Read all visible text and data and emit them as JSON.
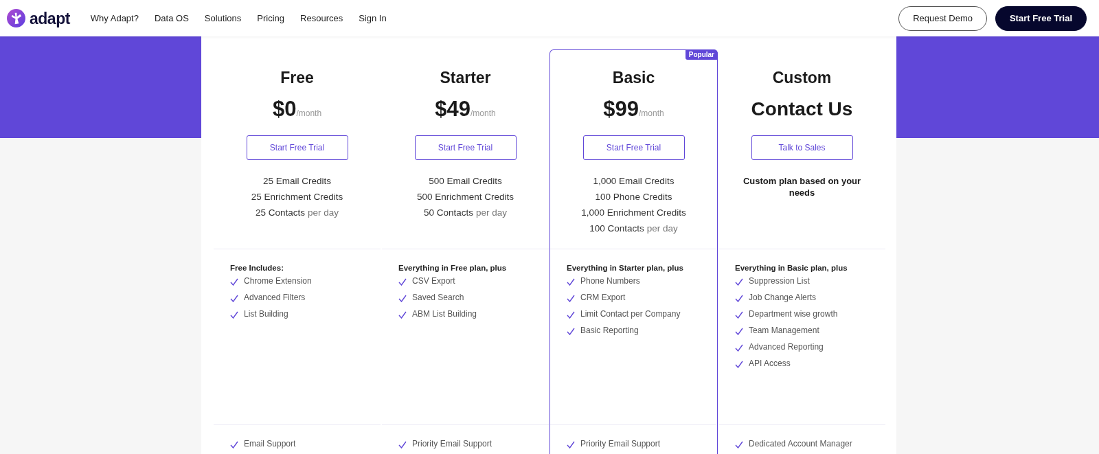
{
  "header": {
    "logo": "adapt",
    "nav": [
      "Why Adapt?",
      "Data OS",
      "Solutions",
      "Pricing",
      "Resources",
      "Sign In"
    ],
    "buttons": [
      {
        "label": "Request Demo",
        "kind": "outline"
      },
      {
        "label": "Start Free Trial",
        "kind": "solid"
      }
    ]
  },
  "plans": [
    {
      "name": "Free",
      "price": {
        "kind": "monthly",
        "amount": "$0",
        "period": "/month"
      },
      "button": "Start Free Trial",
      "highlighted": false,
      "credits": [
        {
          "text": "25 Email Credits"
        },
        {
          "text": "25 Enrichment Credits"
        },
        {
          "text": "25 Contacts",
          "suffix": "per day"
        }
      ],
      "features_title": "Free Includes:",
      "features": [
        "Chrome Extension",
        "Advanced Filters",
        "List Building"
      ],
      "support": [
        "Email Support"
      ]
    },
    {
      "name": "Starter",
      "price": {
        "kind": "monthly",
        "amount": "$49",
        "period": "/month"
      },
      "button": "Start Free Trial",
      "highlighted": false,
      "credits": [
        {
          "text": "500 Email Credits"
        },
        {
          "text": "500 Enrichment Credits"
        },
        {
          "text": "50 Contacts",
          "suffix": "per day"
        }
      ],
      "features_title": "Everything in Free plan, plus",
      "features": [
        "CSV Export",
        "Saved Search",
        "ABM List Building"
      ],
      "support": [
        "Priority Email Support"
      ]
    },
    {
      "name": "Basic",
      "badge": "Popular",
      "price": {
        "kind": "monthly",
        "amount": "$99",
        "period": "/month"
      },
      "button": "Start Free Trial",
      "highlighted": true,
      "credits": [
        {
          "text": "1,000 Email Credits"
        },
        {
          "text": "100 Phone Credits"
        },
        {
          "text": "1,000 Enrichment Credits"
        },
        {
          "text": "100 Contacts",
          "suffix": "per day"
        }
      ],
      "features_title": "Everything in Starter plan, plus",
      "features": [
        "Phone Numbers",
        "CRM Export",
        "Limit Contact per Company",
        "Basic Reporting"
      ],
      "support": [
        "Priority Email Support"
      ]
    },
    {
      "name": "Custom",
      "price": {
        "kind": "contact",
        "amount": "Contact Us"
      },
      "button": "Talk to Sales",
      "highlighted": false,
      "note": "Custom plan based on your needs",
      "features_title": "Everything in Basic plan, plus",
      "features": [
        "Suppression List",
        "Job Change Alerts",
        "Department wise growth",
        "Team Management",
        "Advanced Reporting",
        "API Access"
      ],
      "support": [
        "Dedicated Account Manager"
      ]
    }
  ]
}
